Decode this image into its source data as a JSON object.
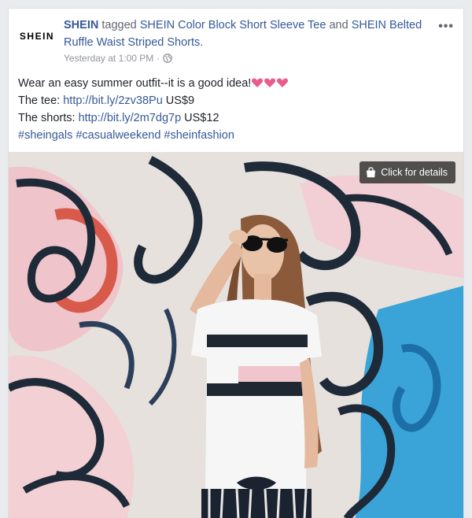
{
  "post": {
    "logo_text": "SHEIN",
    "page_name": "SHEIN",
    "tagged_word": " tagged ",
    "tag_1": "SHEIN Color Block Short Sleeve Tee",
    "and_word": " and ",
    "tag_2": "SHEIN Belted Ruffle Waist Striped Shorts.",
    "timestamp": "Yesterday at 1:00 PM",
    "meta_sep": "·",
    "audience_icon": "globe-icon",
    "more_icon": "•••",
    "text": {
      "line1": "Wear an easy summer outfit--it is a good idea!",
      "line2_prefix": "The tee: ",
      "tee_link": "http://bit.ly/2zv38Pu",
      "tee_price": " US$9",
      "line3_prefix": "The shorts: ",
      "shorts_link": "http://bit.ly/2m7dg7p",
      "shorts_price": " US$12",
      "hashtag_1": "#sheingals",
      "hashtag_2": "#casualweekend",
      "hashtag_3": "#sheinfashion"
    },
    "emoji_icons": [
      "heart-icon",
      "heart-icon",
      "heart-icon"
    ]
  },
  "photo": {
    "details_label": "Click for details",
    "details_icon": "shopping-bag-icon"
  },
  "colors": {
    "link": "#365899",
    "meta": "#90949c",
    "heart": "#e85d8a"
  }
}
